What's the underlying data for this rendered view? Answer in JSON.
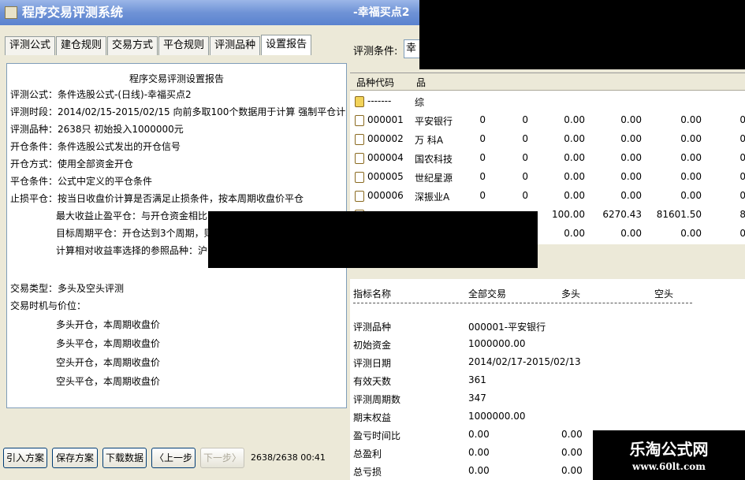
{
  "left_window": {
    "title": "程序交易评测系统",
    "tabs": [
      "评测公式",
      "建仓规则",
      "交易方式",
      "平仓规则",
      "评测品种",
      "设置报告"
    ],
    "report": {
      "title": "程序交易评测设置报告",
      "lines": [
        "评测公式：条件选股公式-(日线)-幸福买点2",
        "评测时段：2014/02/15-2015/02/15 向前多取100个数据用于计算 强制平仓计入收益",
        "评测品种：2638只 初始投入1000000元",
        "开仓条件：条件选股公式发出的开仓信号",
        "开仓方式：使用全部资金开仓",
        "平仓条件：公式中定义的平仓条件",
        "止损平仓：按当日收盘价计算是否满足止损条件，按本周期收盘价平仓",
        "最大收益止盈平仓：与开仓资金相比",
        "目标周期平仓：开仓达到3个周期，则",
        "计算相对收益率选择的参照品种：沪",
        "交易类型：多头及空头评测",
        "交易时机与价位：",
        "多头开仓，本周期收盘价",
        "多头平仓，本周期收盘价",
        "空头开仓，本周期收盘价",
        "空头平仓，本周期收盘价"
      ]
    },
    "buttons": {
      "import": "引入方案",
      "save": "保存方案",
      "download": "下载数据",
      "prev": "〈上一步",
      "next": "下一步〉"
    },
    "status": "2638/2638 00:41"
  },
  "right_window": {
    "title": "-幸福买点2",
    "condition_label": "评测条件:",
    "condition_value": "幸福",
    "grid_headers": [
      "品种代码",
      "品"
    ],
    "rows": [
      {
        "code": "-------",
        "name": "综",
        "c1": "",
        "c2": "",
        "c3": "",
        "c4": "",
        "c5": "",
        "c6": "",
        "icon": "folder-icon"
      },
      {
        "code": "000001",
        "name": "平安银行",
        "c1": "0",
        "c2": "0",
        "c3": "0.00",
        "c4": "0.00",
        "c5": "0.00",
        "c6": "0",
        "icon": "file-icon"
      },
      {
        "code": "000002",
        "name": "万 科A",
        "c1": "0",
        "c2": "0",
        "c3": "0.00",
        "c4": "0.00",
        "c5": "0.00",
        "c6": "0",
        "icon": "file-icon"
      },
      {
        "code": "000004",
        "name": "国农科技",
        "c1": "0",
        "c2": "0",
        "c3": "0.00",
        "c4": "0.00",
        "c5": "0.00",
        "c6": "0",
        "icon": "file-icon"
      },
      {
        "code": "000005",
        "name": "世纪星源",
        "c1": "0",
        "c2": "0",
        "c3": "0.00",
        "c4": "0.00",
        "c5": "0.00",
        "c6": "0",
        "icon": "file-icon"
      },
      {
        "code": "000006",
        "name": "深振业A",
        "c1": "0",
        "c2": "0",
        "c3": "0.00",
        "c4": "0.00",
        "c5": "0.00",
        "c6": "0",
        "icon": "file-icon"
      },
      {
        "code": "",
        "name": "",
        "c1": "",
        "c2": "",
        "c3": "100.00",
        "c4": "6270.43",
        "c5": "81601.50",
        "c6": "8",
        "icon": "file-icon"
      },
      {
        "code": "",
        "name": "",
        "c1": "",
        "c2": "",
        "c3": "0.00",
        "c4": "0.00",
        "c5": "0.00",
        "c6": "0",
        "icon": "file-icon"
      }
    ],
    "stats_headers": [
      "指标名称",
      "全部交易",
      "多头",
      "空头"
    ],
    "stats": [
      {
        "name": "评测品种",
        "all": "000001-平安银行"
      },
      {
        "name": "初始资金",
        "all": "1000000.00"
      },
      {
        "name": "评测日期",
        "all": "2014/02/17-2015/02/13"
      },
      {
        "name": "有效天数",
        "all": "361"
      },
      {
        "name": "评测周期数",
        "all": "347"
      },
      {
        "name": "期末权益",
        "all": "1000000.00"
      },
      {
        "name": "盈亏时间比",
        "all": "0.00",
        "long": "0.00"
      },
      {
        "name": "总盈利",
        "all": "0.00",
        "long": "0.00"
      },
      {
        "name": "总亏损",
        "all": "0.00",
        "long": "0.00"
      }
    ]
  },
  "watermark": {
    "line1": "乐淘公式网",
    "line2": "www.60lt.com"
  }
}
